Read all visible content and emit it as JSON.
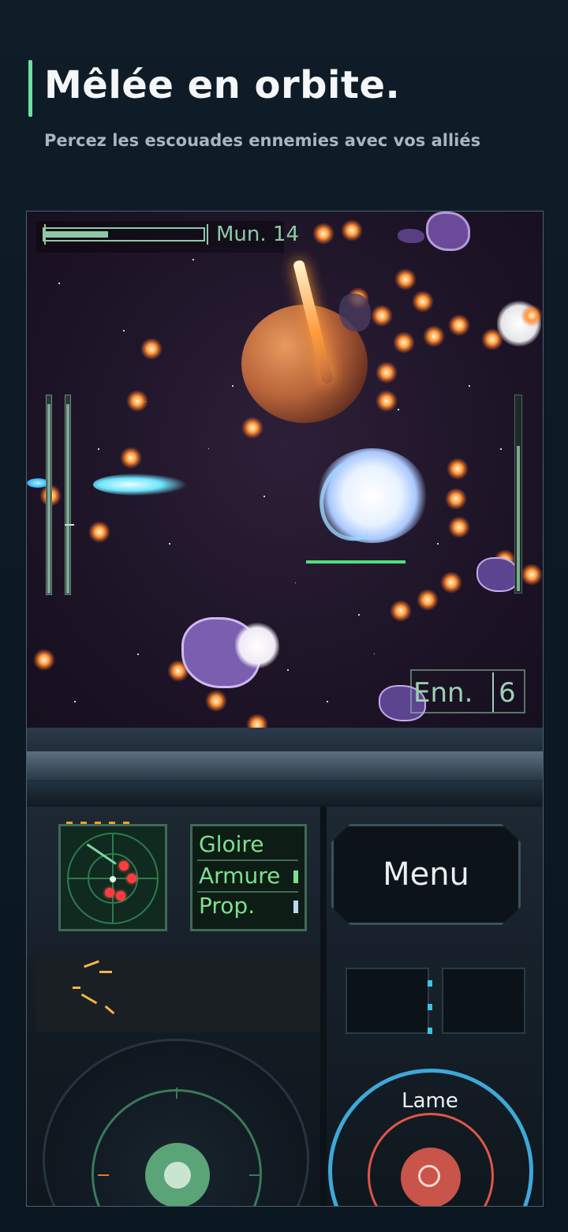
{
  "header": {
    "title": "Mêlée en orbite.",
    "subtitle": "Percez les escouades ennemies avec vos alliés"
  },
  "hud": {
    "ammo_label": "Mun. 14",
    "health_fraction": 0.4,
    "enemies_label": "Enn.",
    "enemies_count": "6"
  },
  "panel": {
    "stats": [
      {
        "label": "Gloire"
      },
      {
        "label": "Armure"
      },
      {
        "label": "Prop."
      }
    ],
    "menu_label": "Menu",
    "action_label": "Lame"
  },
  "colors": {
    "accent": "#6ee0a0",
    "hud_green": "#8ec9a6",
    "stat_green": "#7ee08e",
    "action_ring": "#3fa8d8",
    "action_red": "#c9544a"
  },
  "icons": [
    "radar-icon",
    "joystick-icon",
    "blade-button-icon"
  ]
}
